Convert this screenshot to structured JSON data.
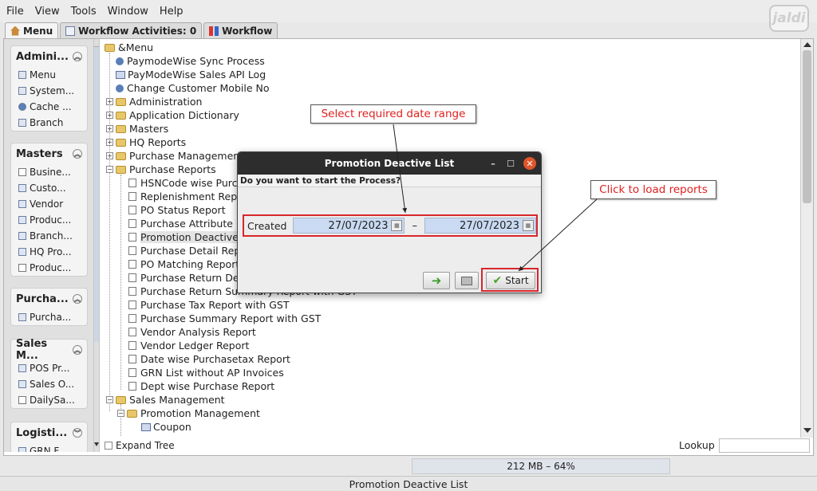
{
  "menubar": {
    "items": [
      "File",
      "View",
      "Tools",
      "Window",
      "Help"
    ]
  },
  "logo": {
    "text": "jaldi"
  },
  "tabs": [
    "Menu",
    "Workflow Activities: 0",
    "Workflow"
  ],
  "sidebar": {
    "groups": [
      {
        "title": "Admini...",
        "items": [
          "Menu",
          "System...",
          "Cache ...",
          "Branch"
        ]
      },
      {
        "title": "Masters",
        "items": [
          "Busine...",
          "Custo...",
          "Vendor",
          "Produc...",
          "Branch...",
          "HQ Pro...",
          "Produc..."
        ]
      },
      {
        "title": "Purcha...",
        "items": [
          "Purcha..."
        ]
      },
      {
        "title": "Sales M...",
        "items": [
          "POS Pr...",
          "Sales O...",
          "DailySa..."
        ]
      },
      {
        "title": "Logisti...",
        "items": [
          "GRN F..."
        ]
      }
    ]
  },
  "tree": {
    "root": "&Menu",
    "nodes": [
      "PaymodeWise Sync Process",
      "PayModeWise Sales API Log",
      "Change Customer Mobile No",
      "Administration",
      "Application Dictionary",
      "Masters",
      "HQ Reports",
      "Purchase Management",
      "Purchase Reports",
      "HSNCode wise Purch",
      "Replenishment Repor",
      "PO Status Report",
      "Purchase Attribute R",
      "Promotion Deactive L",
      "Purchase Detail Repo",
      "PO Matching Report",
      "Purchase Return Det",
      "Purchase Return Summary Report with GST",
      "Purchase Tax Report with GST",
      "Purchase Summary Report with GST",
      "Vendor Analysis Report",
      "Vendor Ledger Report",
      "Date wise Purchasetax Report",
      "GRN List without AP Invoices",
      "Dept wise Purchase Report",
      "Sales Management",
      "Promotion Management",
      "Coupon"
    ]
  },
  "bottom": {
    "expand_tree": "Expand Tree",
    "lookup_label": "Lookup",
    "lookup_value": ""
  },
  "memory": "212 MB – 64%",
  "status": "Promotion Deactive List",
  "dialog": {
    "title": "Promotion Deactive List",
    "question": "Do you want to start the Process?",
    "created_label": "Created",
    "date_from": "27/07/2023",
    "separator": "–",
    "date_to": "27/07/2023",
    "start_label": "Start"
  },
  "annotations": {
    "select_range": "Select required date range",
    "click_load": "Click to load reports"
  },
  "colors": {
    "highlight_red": "#d8262c",
    "callout_text": "#e0201f",
    "date_field": "#c9daf2"
  }
}
